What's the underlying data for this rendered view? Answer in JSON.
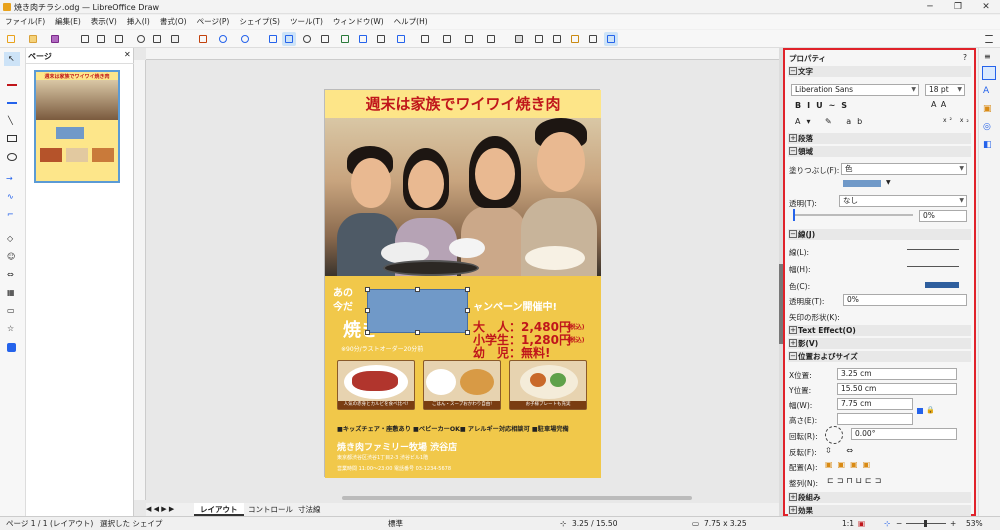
{
  "window": {
    "title": "焼き肉チラシ.odg — LibreOffice Draw",
    "buttons": [
      "─",
      "❐",
      "✕"
    ]
  },
  "menu": [
    "ファイル(F)",
    "編集(E)",
    "表示(V)",
    "挿入(I)",
    "書式(O)",
    "ページ(P)",
    "シェイプ(S)",
    "ツール(T)",
    "ウィンドウ(W)",
    "ヘルプ(H)"
  ],
  "pages_panel": {
    "title": "ページ",
    "page_number": "1",
    "thumb_title": "週末は家族でワイワイ焼き肉"
  },
  "flyer": {
    "headline": "週末は家族でワイワイ焼き肉",
    "partial_left": "あの",
    "partial_left2": "今だ",
    "partial_right": "ャンペーン開催中!",
    "partial_big": "焼き",
    "partial_small": "※90分/ラストオーダー20分前",
    "price_adult": "大　人：2,480円",
    "price_adult_tax": "(税込)",
    "price_student": "小学生：1,280円",
    "price_student_tax": "(税込)",
    "price_child": "幼　児：無料!",
    "food_caption_1": "人気の赤身とカルビを食べ比べ!",
    "food_caption_2": "ごはん・スープおかわり自由!",
    "food_caption_3": "お子様プレートも充実",
    "features": "■キッズチェア・座敷あり ■ベビーカーOK■ アレルギー対応相談可 ■駐車場完備",
    "store_name": "焼き肉ファミリー牧場 渋谷店",
    "address": "東京都渋谷区渋谷1丁目2-3 渋谷ビル1階",
    "contact": "営業時間 11:00〜23:00 電話番号 03-1234-5678"
  },
  "sheet_tabs": [
    "レイアウト",
    "コントロール",
    "寸法線"
  ],
  "sidebar": {
    "title": "プロパティ",
    "help": "?",
    "sections": {
      "text": "文字",
      "paragraph": "段落",
      "area": "領域",
      "line": "線(J)",
      "text_effect": "Text Effect(O)",
      "shadow": "影(V)",
      "position": "位置およびサイズ",
      "group": "段組み",
      "effect": "効果"
    },
    "font_name": "Liberation Sans",
    "font_size": "18 pt",
    "fill_label": "塗りつぶし(F):",
    "fill_value": "色",
    "transparency_label": "透明(T):",
    "transparency_value": "なし",
    "transparency_pct": "0%",
    "line_label": "線(L):",
    "width_label": "幅(H):",
    "color_label": "色(C):",
    "line_transparency_label": "透明度(T):",
    "line_transparency_value": "0%",
    "arrow_label": "矢印の形状(K):",
    "x_label": "X位置:",
    "x_value": "3.25 cm",
    "y_label": "Y位置:",
    "y_value": "15.50 cm",
    "w_label": "幅(W):",
    "w_value": "7.75 cm",
    "h_label": "高さ(E):",
    "h_value": "",
    "rotate_label": "回転(R):",
    "rotate_value": "0.00°",
    "flip_label": "反転(F):",
    "arrange_label": "配置(A):",
    "align_label": "整列(N):",
    "fill_color": "#7099c8",
    "line_color": "#2f5f9e"
  },
  "status": {
    "page": "ページ 1 / 1 (レイアウト)",
    "selection": "選択した シェイプ",
    "style": "標準",
    "position": "3.25 / 15.50",
    "size": "7.75 x 3.25",
    "scale": "1:1",
    "zoom": "53%"
  }
}
